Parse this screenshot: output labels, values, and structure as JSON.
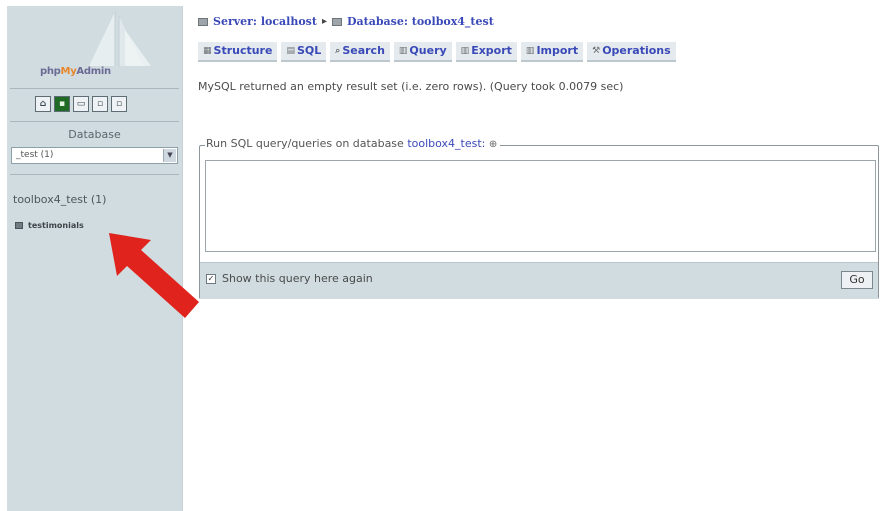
{
  "logo": {
    "part1": "php",
    "part2": "My",
    "part3": "Admin"
  },
  "nav": {
    "icons": [
      "home-icon",
      "sql-query-icon",
      "query-window-icon",
      "docs-icon",
      "reload-icon"
    ],
    "database_label": "Database",
    "database_select": "_test (1)",
    "database_name": "toolbox4_test (1)",
    "tables": [
      "testimonials"
    ]
  },
  "breadcrumb": {
    "server": "Server: localhost",
    "separator": "▸",
    "database": "Database: toolbox4_test"
  },
  "tabs": [
    {
      "label": "Structure",
      "icon": "structure-icon"
    },
    {
      "label": "SQL",
      "icon": "sql-icon"
    },
    {
      "label": "Search",
      "icon": "search-icon"
    },
    {
      "label": "Query",
      "icon": "query-icon"
    },
    {
      "label": "Export",
      "icon": "export-icon"
    },
    {
      "label": "Import",
      "icon": "import-icon"
    },
    {
      "label": "Operations",
      "icon": "operations-icon"
    }
  ],
  "result_message": "MySQL returned an empty result set (i.e. zero rows). (Query took 0.0079 sec)",
  "sql_panel": {
    "legend_prefix": "Run SQL query/queries on database",
    "legend_db": "toolbox4_test:",
    "query_text": "",
    "show_again_label": "Show this query here again",
    "show_again_checked": true,
    "go_label": "Go"
  },
  "colors": {
    "accent": "#3a49b8",
    "nav_bg": "#d0dce0",
    "arrow": "#e0231c"
  }
}
